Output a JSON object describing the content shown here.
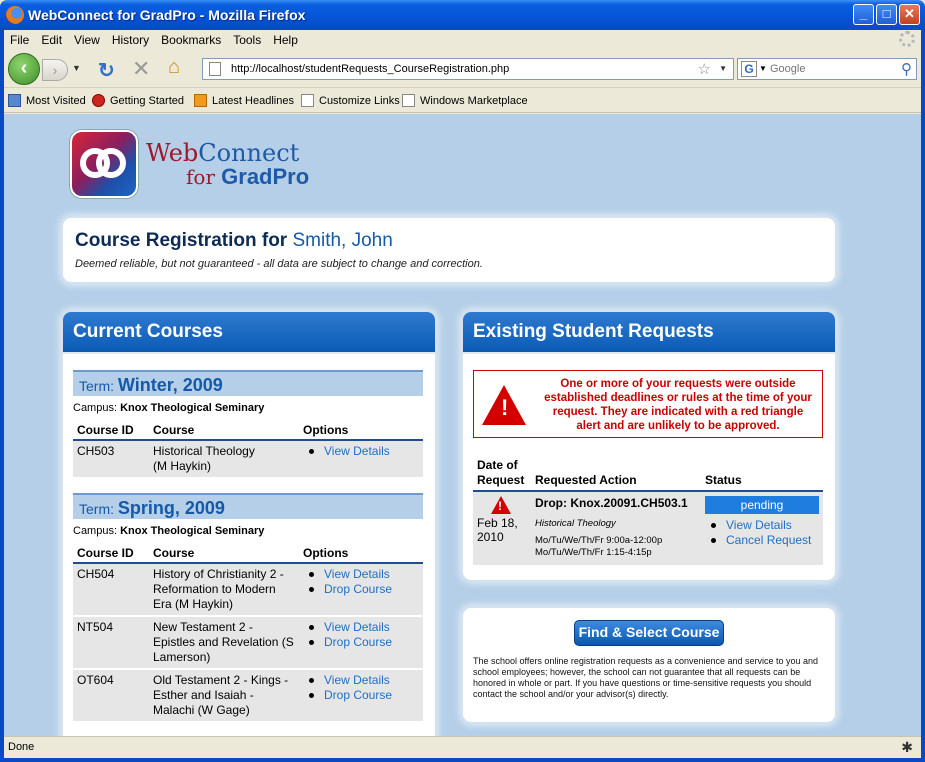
{
  "window": {
    "title": "WebConnect for GradPro - Mozilla Firefox"
  },
  "menu": [
    "File",
    "Edit",
    "View",
    "History",
    "Bookmarks",
    "Tools",
    "Help"
  ],
  "address": {
    "url": "http://localhost/studentRequests_CourseRegistration.php"
  },
  "search": {
    "placeholder": "Google"
  },
  "bookmarks": [
    "Most Visited",
    "Getting Started",
    "Latest Headlines",
    "Customize Links",
    "Windows Marketplace"
  ],
  "brand": {
    "web": "Web",
    "connect": "Connect",
    "for": "for",
    "gradpro": "GradPro"
  },
  "registration": {
    "title": "Course Registration for",
    "student": "Smith, John",
    "subtitle": "Deemed reliable, but not guaranteed - all data are subject to change and correction."
  },
  "current_courses": {
    "heading": "Current Courses",
    "term_label": "Term:",
    "campus_label": "Campus:",
    "columns": [
      "Course ID",
      "Course",
      "Options"
    ],
    "terms": [
      {
        "name": "Winter, 2009",
        "campus": "Knox Theological Seminary",
        "rows": [
          {
            "id": "CH503",
            "course": "Historical Theology",
            "instructor": "(M Haykin)",
            "options": [
              "View Details"
            ]
          }
        ]
      },
      {
        "name": "Spring, 2009",
        "campus": "Knox Theological Seminary",
        "rows": [
          {
            "id": "CH504",
            "course": "History of Christianity 2 - Reformation to Modern Era (M Haykin)",
            "options": [
              "View Details",
              "Drop Course"
            ]
          },
          {
            "id": "NT504",
            "course": "New Testament 2 - Epistles and Revelation (S Lamerson)",
            "options": [
              "View Details",
              "Drop Course"
            ]
          },
          {
            "id": "OT604",
            "course": "Old Testament 2 - Kings - Esther and Isaiah - Malachi (W Gage)",
            "options": [
              "View Details",
              "Drop Course"
            ]
          }
        ]
      }
    ]
  },
  "requests": {
    "heading": "Existing Student Requests",
    "alert": "One or more of your requests were outside established deadlines or rules at the time of your request. They are indicated with a red triangle alert and are unlikely to be approved.",
    "columns": {
      "date1": "Date of",
      "date2": "Request",
      "action": "Requested Action",
      "status": "Status"
    },
    "row": {
      "date": "Feb 18, 2010",
      "action": "Drop: Knox.20091.CH503.1",
      "course": "Historical Theology",
      "sched1": "Mo/Tu/We/Th/Fr 9:00a-12:00p",
      "sched2": "Mo/Tu/We/Th/Fr 1:15-4:15p",
      "status": "pending",
      "links": [
        "View Details",
        "Cancel Request"
      ]
    }
  },
  "find": {
    "button": "Find & Select Course",
    "note": "The school offers online registration requests as a convenience and service to you and school employees; however, the school can not guarantee that all requests can be honored in whole or part. If you have questions or time-sensitive requests you should contact the school and/or your advisor(s) directly."
  },
  "status": {
    "text": "Done"
  }
}
